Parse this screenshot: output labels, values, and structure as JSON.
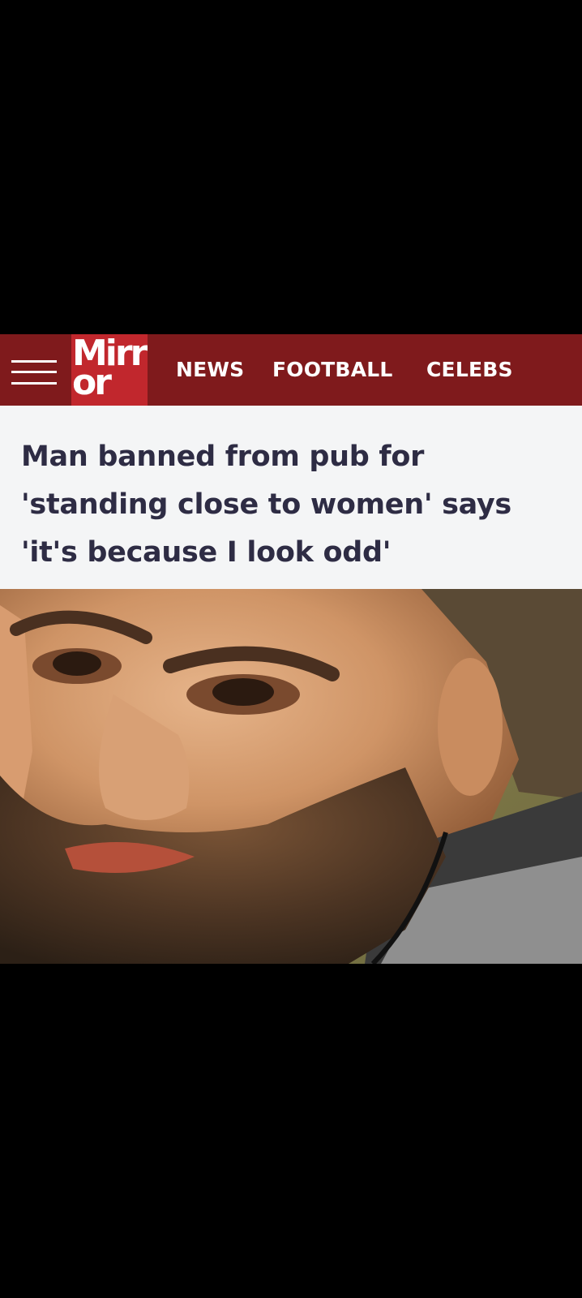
{
  "header": {
    "logo_line1": "Mirr",
    "logo_line2": "or",
    "nav": [
      "NEWS",
      "FOOTBALL",
      "CELEBS"
    ]
  },
  "article": {
    "headline": "Man banned from pub for 'standing close to women' says 'it's because I look odd'"
  },
  "colors": {
    "nav_background": "#7f1a1c",
    "logo_background": "#c1272d",
    "headline_text": "#2e2c44",
    "headline_background": "#f4f5f6"
  },
  "icons": {
    "menu": "hamburger-menu-icon"
  }
}
